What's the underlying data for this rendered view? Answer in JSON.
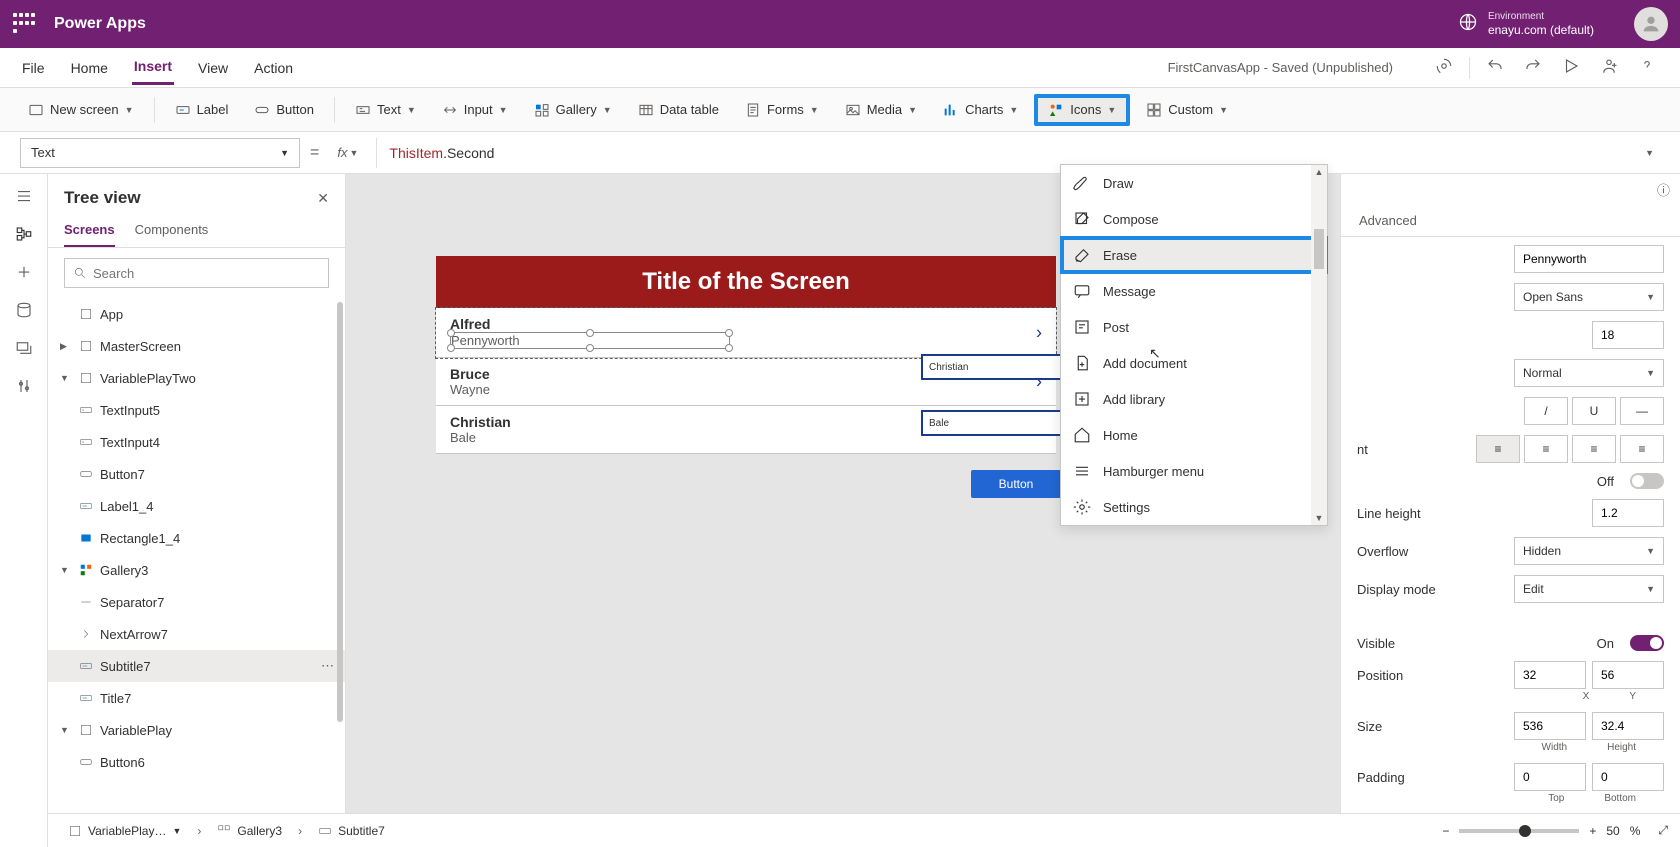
{
  "header": {
    "app_title": "Power Apps",
    "env_label": "Environment",
    "env_name": "enayu.com (default)"
  },
  "menubar": {
    "items": [
      "File",
      "Home",
      "Insert",
      "View",
      "Action"
    ],
    "active": "Insert",
    "doc_status": "FirstCanvasApp - Saved (Unpublished)"
  },
  "ribbon": {
    "new_screen": "New screen",
    "label": "Label",
    "button": "Button",
    "text": "Text",
    "input": "Input",
    "gallery": "Gallery",
    "data_table": "Data table",
    "forms": "Forms",
    "media": "Media",
    "charts": "Charts",
    "icons": "Icons",
    "custom": "Custom"
  },
  "formula": {
    "prop": "Text",
    "fx": "fx",
    "expr_a": "ThisItem",
    "expr_b": ".Second"
  },
  "treeview": {
    "title": "Tree view",
    "tab_screens": "Screens",
    "tab_components": "Components",
    "search_ph": "Search",
    "nodes": {
      "app": "App",
      "master": "MasterScreen",
      "vp2": "VariablePlayTwo",
      "ti5": "TextInput5",
      "ti4": "TextInput4",
      "btn7": "Button7",
      "lbl14": "Label1_4",
      "rect14": "Rectangle1_4",
      "gal3": "Gallery3",
      "sep7": "Separator7",
      "next7": "NextArrow7",
      "sub7": "Subtitle7",
      "title7": "Title7",
      "vp": "VariablePlay",
      "btn6": "Button6"
    }
  },
  "stage": {
    "screen_title": "Title of the Screen",
    "rows": [
      {
        "first": "Alfred",
        "second": "Pennyworth"
      },
      {
        "first": "Bruce",
        "second": "Wayne"
      },
      {
        "first": "Christian",
        "second": "Bale"
      }
    ],
    "input1": "Christian",
    "input2": "Bale",
    "button_label": "Button"
  },
  "icons_dropdown": {
    "items": [
      "Draw",
      "Compose",
      "Erase",
      "Message",
      "Post",
      "Add document",
      "Add library",
      "Home",
      "Hamburger menu",
      "Settings"
    ],
    "highlighted": "Erase"
  },
  "props": {
    "tab_advanced": "Advanced",
    "text_value": "Pennyworth",
    "font": "Open Sans",
    "font_size": "18",
    "font_weight": "Normal",
    "italic": "/",
    "underline": "U",
    "strike": "—",
    "auto_height_lbl": "nt",
    "auto_height_off": "Off",
    "line_height_lbl": "Line height",
    "line_height": "1.2",
    "overflow_lbl": "Overflow",
    "overflow": "Hidden",
    "display_mode_lbl": "Display mode",
    "display_mode": "Edit",
    "visible_lbl": "Visible",
    "visible_on": "On",
    "position_lbl": "Position",
    "pos_x": "32",
    "pos_y": "56",
    "pos_x_lbl": "X",
    "pos_y_lbl": "Y",
    "size_lbl": "Size",
    "size_w": "536",
    "size_h": "32.4",
    "size_w_lbl": "Width",
    "size_h_lbl": "Height",
    "padding_lbl": "Padding",
    "pad_t": "0",
    "pad_b": "0",
    "pad_t_lbl": "Top",
    "pad_b_lbl": "Bottom"
  },
  "breadcrumb": {
    "c1": "VariablePlay…",
    "c2": "Gallery3",
    "c3": "Subtitle7",
    "zoom": "50",
    "zoom_pct": "%"
  }
}
